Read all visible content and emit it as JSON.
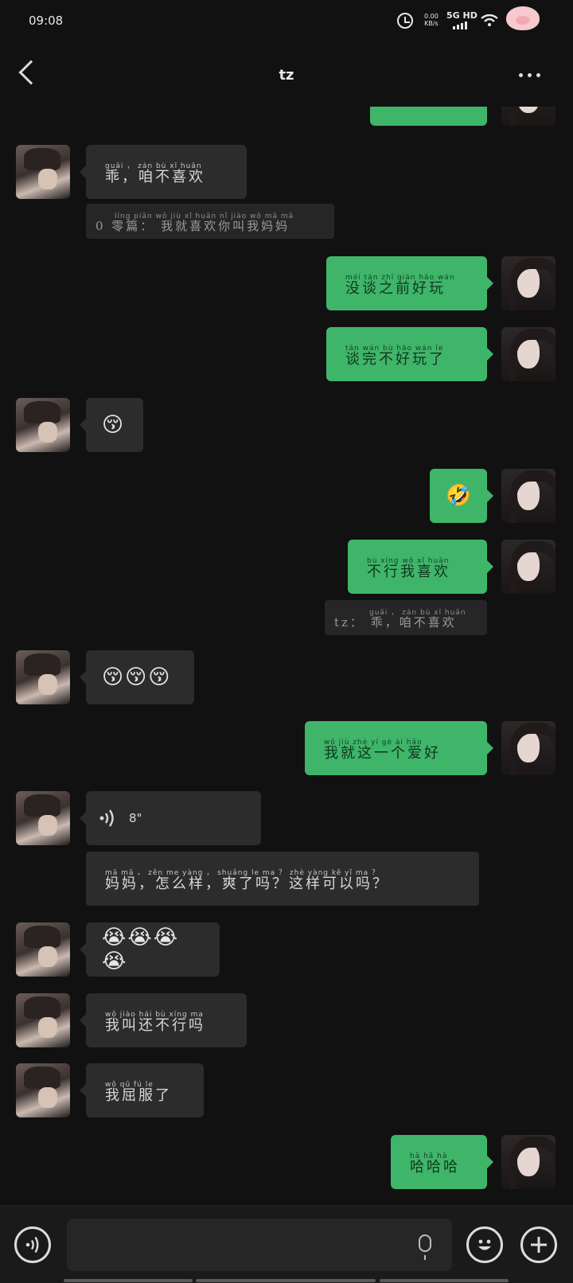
{
  "status": {
    "time": "09:08",
    "speed_top": "0.00",
    "speed_bottom": "KB/s",
    "network": "5G HD"
  },
  "header": {
    "title": "tz"
  },
  "messages": {
    "m0_py": "",
    "m1_py": "guāi ， zán bù xǐ huān",
    "m1_text": "乖，咱不喜欢",
    "q1_py": "líng piān    wǒ jiù xǐ huān nǐ jiào wǒ mā mā",
    "q1_text": "0 零篇： 我就喜欢你叫我妈妈",
    "m2_py": "méi tán zhī qián hǎo wán",
    "m2_text": "没谈之前好玩",
    "m3_py": "tán wán bù hǎo wán le",
    "m3_text": "谈完不好玩了",
    "m4_emoji": "😚",
    "m5_emoji": "🤣",
    "m6_py": "bù xíng wǒ xǐ huān",
    "m6_text": "不行我喜欢",
    "q2_py": "guāi ， zán bù xǐ huān",
    "q2_text": "tz： 乖，咱不喜欢",
    "m7_emoji": "😚😚😚",
    "m8_py": "wǒ jiù zhè yí gè ài hǎo",
    "m8_text": "我就这一个爱好",
    "m9_duration": "8\"",
    "q3_py": "mā mā ， zěn me yàng ， shuǎng le ma ？ zhè yàng kě yǐ ma ？",
    "q3_text": "妈妈，怎么样，爽了吗？这样可以吗？",
    "m10_emoji": "😭😭😭😭",
    "m11_py": "wǒ jiào hái bù xíng ma",
    "m11_text": "我叫还不行吗",
    "m12_py": "wǒ qū fú le",
    "m12_text": "我屈服了",
    "m13_py": "hā hā hā",
    "m13_text": "哈哈哈"
  }
}
